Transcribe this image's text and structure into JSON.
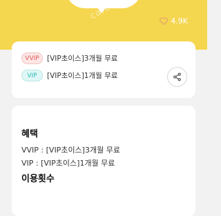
{
  "header": {
    "watermark": "cafe.n",
    "likes_count": "4.9K",
    "heart_color": "#e6a86a"
  },
  "offers": [
    {
      "badge": "VVIP",
      "text": "[VIP초이스]3개월 무료"
    },
    {
      "badge": "VIP",
      "text": "[VIP초이스]1개월 무료"
    }
  ],
  "details": {
    "benefit_title": "혜택",
    "benefit_lines": [
      "VVIP : [VIP초이스]3개월 무료",
      "VIP : [VIP초이스]1개월 무료"
    ],
    "usage_title": "이용횟수"
  },
  "colors": {
    "hero_yellow": "#f5d64f",
    "vvip_accent": "#e25b5b",
    "vip_accent": "#2dbab5"
  }
}
